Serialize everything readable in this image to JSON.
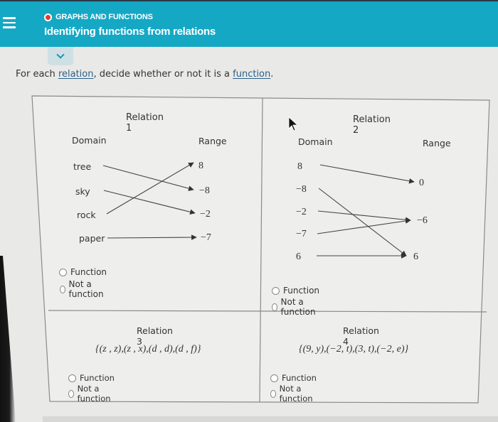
{
  "header": {
    "menu_icon": "hamburger-menu-icon",
    "status_dot_color": "#e43a30",
    "breadcrumb": "GRAPHS AND FUNCTIONS",
    "title": "Identifying functions from relations",
    "collapse_icon": "chevron-down-icon"
  },
  "colors": {
    "header_bg": "#15a8c5",
    "page_bg": "#e9e9e7",
    "link": "#2b5f8a"
  },
  "instruction": {
    "prefix": "For each ",
    "link1": "relation",
    "middle": ", decide whether or not it is a ",
    "link2": "function",
    "suffix": "."
  },
  "relations": [
    {
      "title": "Relation 1",
      "type": "mapping",
      "domain_label": "Domain",
      "range_label": "Range",
      "domain": [
        "tree",
        "sky",
        "rock",
        "paper"
      ],
      "range": [
        "8",
        "−8",
        "−2",
        "−7"
      ],
      "mappings": [
        {
          "from": "tree",
          "to": "−8"
        },
        {
          "from": "sky",
          "to": "−2"
        },
        {
          "from": "rock",
          "to": "8"
        },
        {
          "from": "paper",
          "to": "−7"
        }
      ],
      "options": [
        "Function",
        "Not a function"
      ],
      "selected": null
    },
    {
      "title": "Relation 2",
      "type": "mapping",
      "domain_label": "Domain",
      "range_label": "Range",
      "domain": [
        "8",
        "−8",
        "−2",
        "−7",
        "6"
      ],
      "range": [
        "0",
        "−6",
        "6"
      ],
      "mappings": [
        {
          "from": "8",
          "to": "0"
        },
        {
          "from": "−8",
          "to": "6"
        },
        {
          "from": "−2",
          "to": "−6"
        },
        {
          "from": "−7",
          "to": "−6"
        },
        {
          "from": "6",
          "to": "6"
        }
      ],
      "options": [
        "Function",
        "Not a function"
      ],
      "selected": null
    },
    {
      "title": "Relation 3",
      "type": "set",
      "set": "{(z , z),(z , x),(d , d),(d , f)}",
      "options": [
        "Function",
        "Not a function"
      ],
      "selected": null
    },
    {
      "title": "Relation 4",
      "type": "set",
      "set": "{(9, y),(−2, t),(3, t),(−2, e)}",
      "options": [
        "Function",
        "Not a function"
      ],
      "selected": null
    }
  ]
}
